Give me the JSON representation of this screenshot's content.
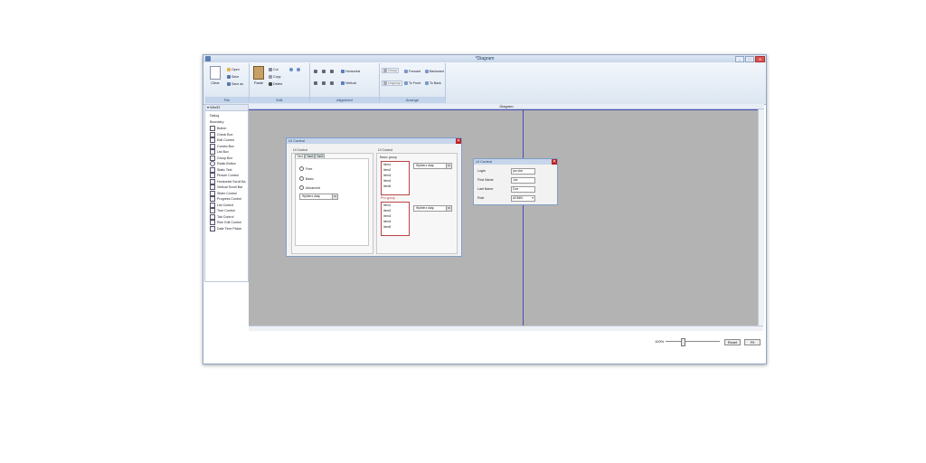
{
  "window": {
    "title": "*Diagram",
    "min": "–",
    "max": "□",
    "close": "✕"
  },
  "ribbon": {
    "file": {
      "label": "File",
      "clear": "Clear",
      "open": "Open",
      "save": "Save",
      "save_as": "Save as"
    },
    "edit": {
      "label": "Edit",
      "paste": "Paste",
      "cut": "Cut",
      "copy": "Copy",
      "delete": "Delete"
    },
    "alignment": {
      "label": "Alignment",
      "horizontal": "Horizontal",
      "vertical": "Vertical"
    },
    "arrange": {
      "label": "Arrange",
      "group": "Group",
      "ungroup": "Ungroup",
      "forward": "Forward",
      "backward": "Backward",
      "to_front": "To Front",
      "to_back": "To Back"
    }
  },
  "toolbox": {
    "header": "Win32",
    "items": [
      "Dialog",
      "Boundary",
      "Button",
      "Check Box",
      "Edit Control",
      "Combo Box",
      "List Box",
      "Group Box",
      "Radio Button",
      "Static Text",
      "Picture Control",
      "Horizontal Scroll Ba",
      "Vertical Scroll Bar",
      "Slider Control",
      "Progress Control",
      "List Control",
      "Tree Control",
      "Tab Control",
      "Rich Edit Control",
      "Date Time Picker"
    ]
  },
  "diagram": {
    "header": "Diagram"
  },
  "dialog1": {
    "title": "UI Control",
    "close": "✕",
    "left_group": "UI Control",
    "tabs": [
      "Tab1",
      "Tab2",
      "Tab3"
    ],
    "radios": [
      "Free",
      "Basic",
      "Advanced"
    ],
    "date_left": "Wybierz datę",
    "date_btn": "15",
    "right_group": "UI Control",
    "basic_group": "Basic group",
    "pro_group": "Pro group",
    "list1": [
      "item1",
      "item2",
      "item3",
      "item4",
      "item5"
    ],
    "list2": [
      "item1",
      "item2",
      "item3",
      "item4",
      "item5"
    ],
    "date_r1": "Wybierz datę",
    "date_r2": "Wybierz datę"
  },
  "dialog2": {
    "title": "UI Control",
    "close": "✕",
    "fields": [
      {
        "label": "Login",
        "value": "joe.doe"
      },
      {
        "label": "First Name",
        "value": "Joe"
      },
      {
        "label": "Last Name",
        "value": "Doe"
      },
      {
        "label": "Role",
        "value": "ADMIN"
      }
    ]
  },
  "footer": {
    "zoom": "100%",
    "reset": "Reset",
    "fit": "Fit"
  },
  "colors": {
    "canvas": "#b3b3b3",
    "page_border": "#4b4bb0",
    "ribbon_group_label": "#c4d4ea",
    "close_red": "#b22222"
  }
}
